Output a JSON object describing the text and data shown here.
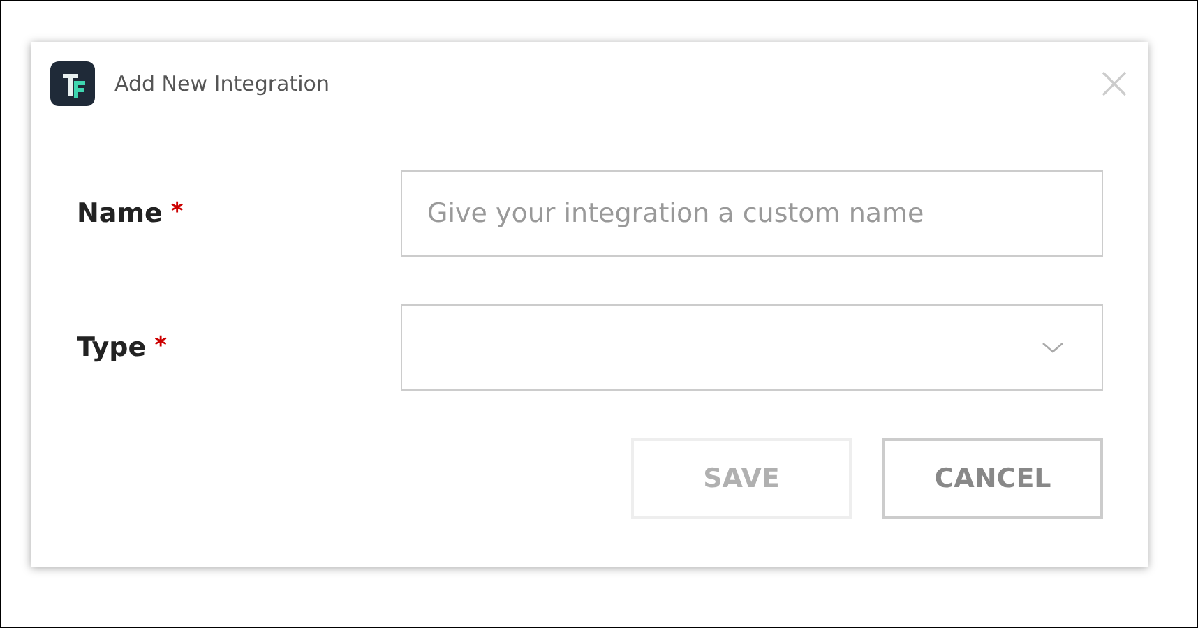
{
  "dialog": {
    "title": "Add New Integration",
    "fields": [
      {
        "kind": "text",
        "label": "Name",
        "required_mark": "*",
        "placeholder": "Give your integration a custom name"
      },
      {
        "kind": "select",
        "label": "Type",
        "required_mark": "*"
      }
    ],
    "buttons": [
      {
        "label": "SAVE",
        "disabled": true
      },
      {
        "label": "CANCEL",
        "disabled": false
      }
    ]
  }
}
